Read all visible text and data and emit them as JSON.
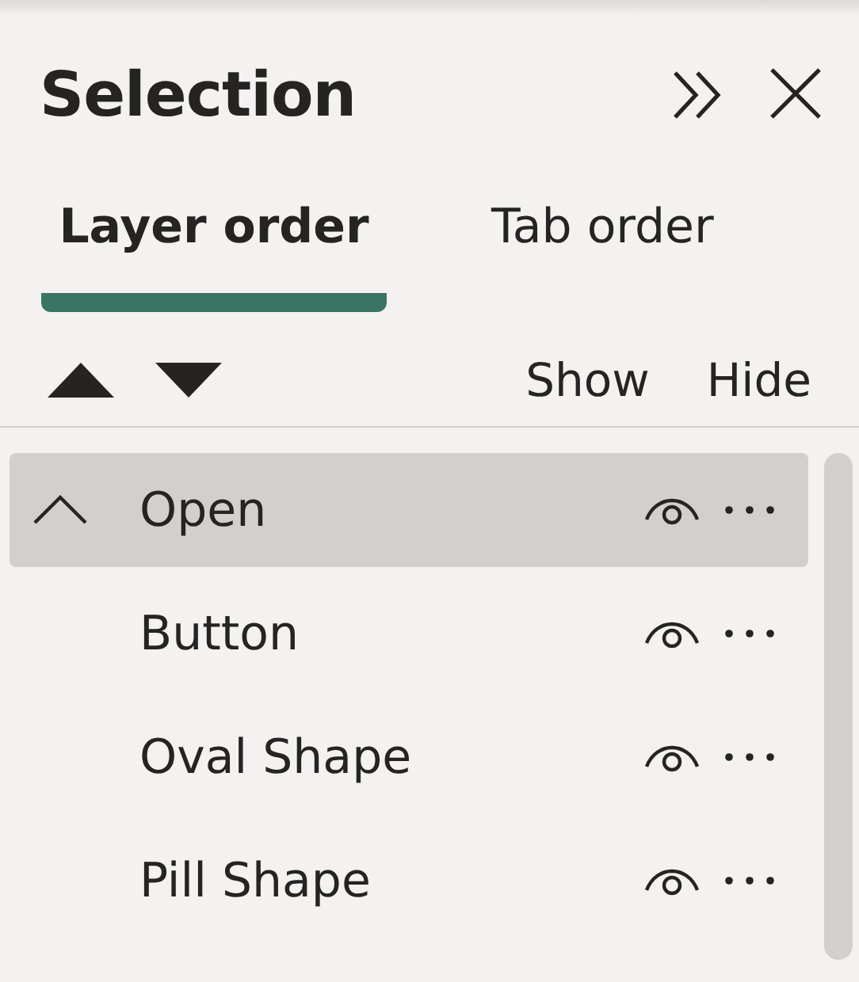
{
  "panel": {
    "title": "Selection"
  },
  "tabs": [
    {
      "label": "Layer order",
      "selected": true
    },
    {
      "label": "Tab order",
      "selected": false
    }
  ],
  "actions": [
    "Show",
    "Hide"
  ],
  "layers": [
    {
      "name": "Open",
      "kind": "group",
      "expanded": true,
      "selected": true
    },
    {
      "name": "Button",
      "kind": "item",
      "selected": false
    },
    {
      "name": "Oval Shape",
      "kind": "item",
      "selected": false
    },
    {
      "name": "Pill Shape",
      "kind": "item",
      "selected": false
    }
  ]
}
